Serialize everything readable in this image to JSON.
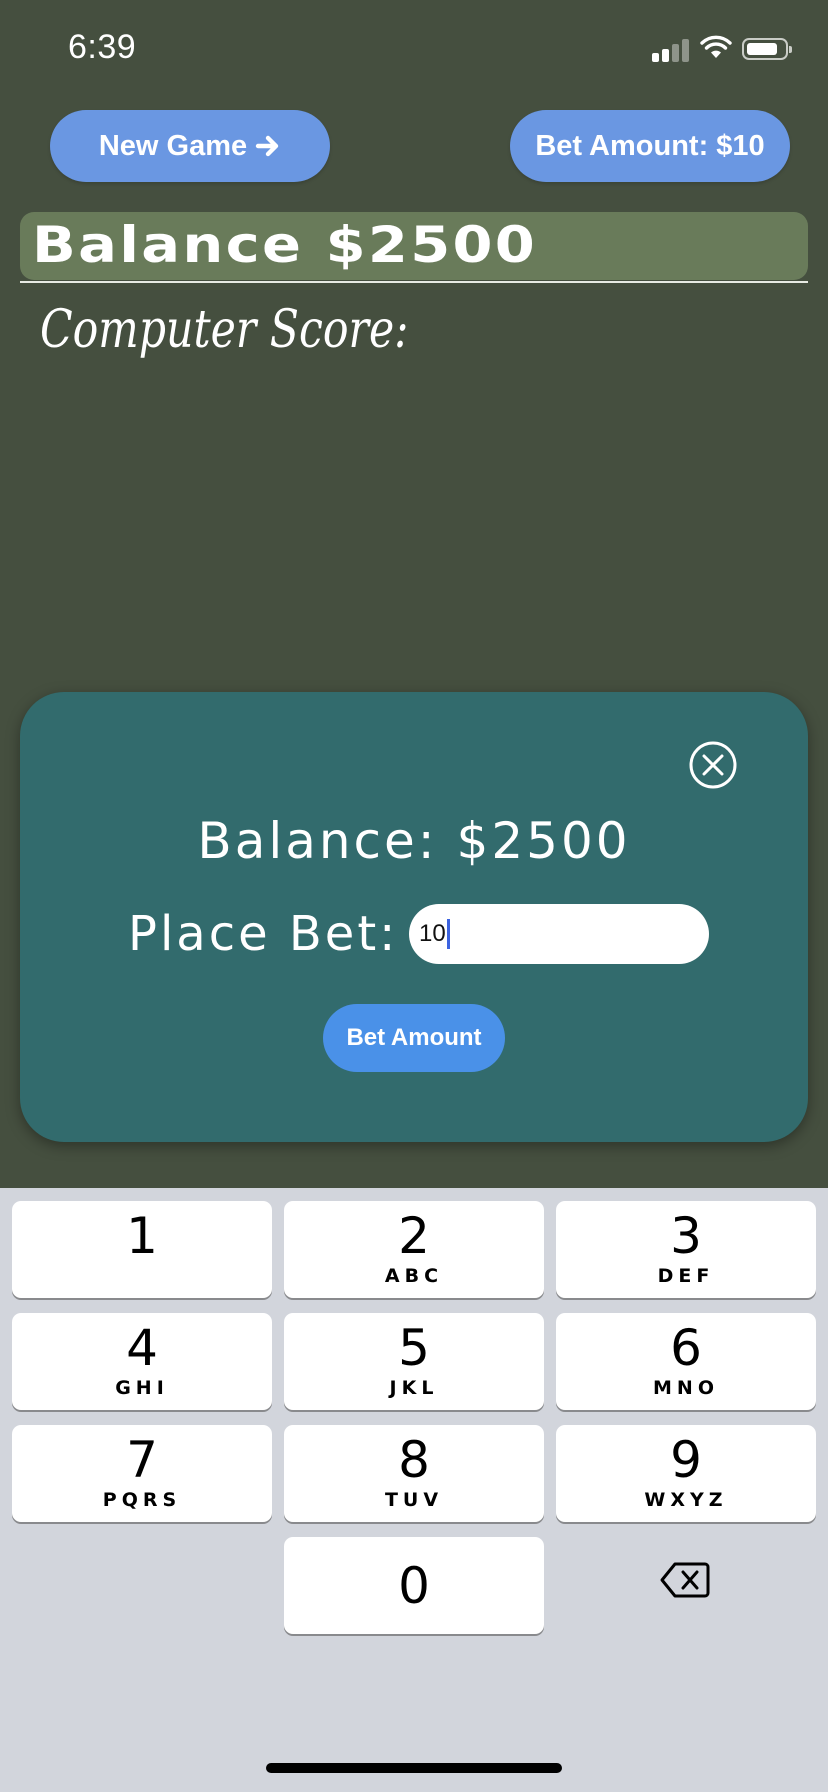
{
  "status_bar": {
    "time": "6:39"
  },
  "header": {
    "new_game_label": "New Game",
    "bet_amount_label": "Bet Amount: $10",
    "balance_label": "Balance $2500"
  },
  "game": {
    "computer_score_label": "Computer Score:"
  },
  "bet_modal": {
    "balance_text": "Balance: $2500",
    "place_bet_label": "Place Bet:",
    "bet_input_value": "10",
    "submit_label": "Bet Amount"
  },
  "keyboard": {
    "keys": [
      {
        "num": "1",
        "letters": ""
      },
      {
        "num": "2",
        "letters": "ABC"
      },
      {
        "num": "3",
        "letters": "DEF"
      },
      {
        "num": "4",
        "letters": "GHI"
      },
      {
        "num": "5",
        "letters": "JKL"
      },
      {
        "num": "6",
        "letters": "MNO"
      },
      {
        "num": "7",
        "letters": "PQRS"
      },
      {
        "num": "8",
        "letters": "TUV"
      },
      {
        "num": "9",
        "letters": "WXYZ"
      },
      {
        "num": "0",
        "letters": ""
      }
    ]
  },
  "colors": {
    "background": "#454f3f",
    "accent_button": "#6a97e2",
    "balance_bar": "#697b5a",
    "modal": "#326b6d",
    "keyboard_bg": "#d2d5dc"
  },
  "icons": [
    "arrow-right-icon",
    "close-circle-icon",
    "backspace-icon",
    "signal-icon",
    "wifi-icon",
    "battery-icon"
  ]
}
